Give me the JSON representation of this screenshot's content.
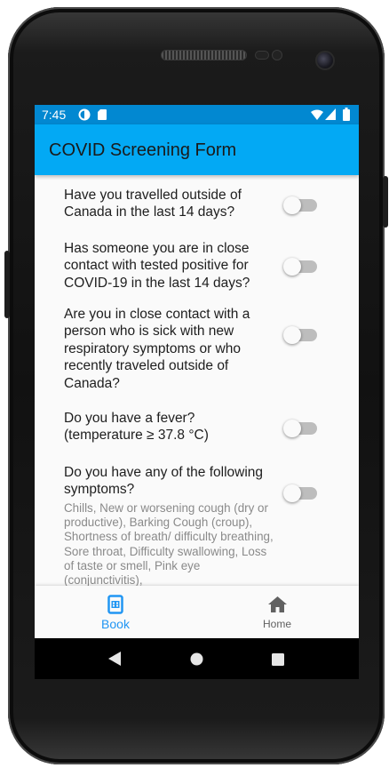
{
  "status_bar": {
    "time": "7:45"
  },
  "app_bar": {
    "title": "COVID Screening Form"
  },
  "questions": [
    {
      "text": "Have you travelled outside of Canada in the last 14 days?",
      "value": false
    },
    {
      "text": "Has someone you are in close contact with tested positive for COVID-19 in the last 14 days?",
      "value": false
    },
    {
      "text": "Are you in close contact with a person who is sick with new respiratory symptoms or who recently traveled outside of Canada?",
      "value": false
    },
    {
      "text": "Do you have a fever? (temperature ≥ 37.8 °C)",
      "value": false
    },
    {
      "text": "Do you have any of the following symptoms?",
      "detail": "Chills, New or worsening cough (dry or productive), Barking Cough (croup), Shortness of breath/ difficulty breathing, Sore throat, Difficulty swallowing, Loss of taste or smell, Pink eye (conjunctivitis),",
      "value": false
    }
  ],
  "bottom_nav": [
    {
      "label": "Book",
      "icon": "book-calendar-icon",
      "active": true
    },
    {
      "label": "Home",
      "icon": "home-icon",
      "active": false
    }
  ],
  "colors": {
    "status_bar": "#0288d1",
    "app_bar": "#03a9f4",
    "active_nav": "#2196f3",
    "inactive_nav": "#616161"
  }
}
